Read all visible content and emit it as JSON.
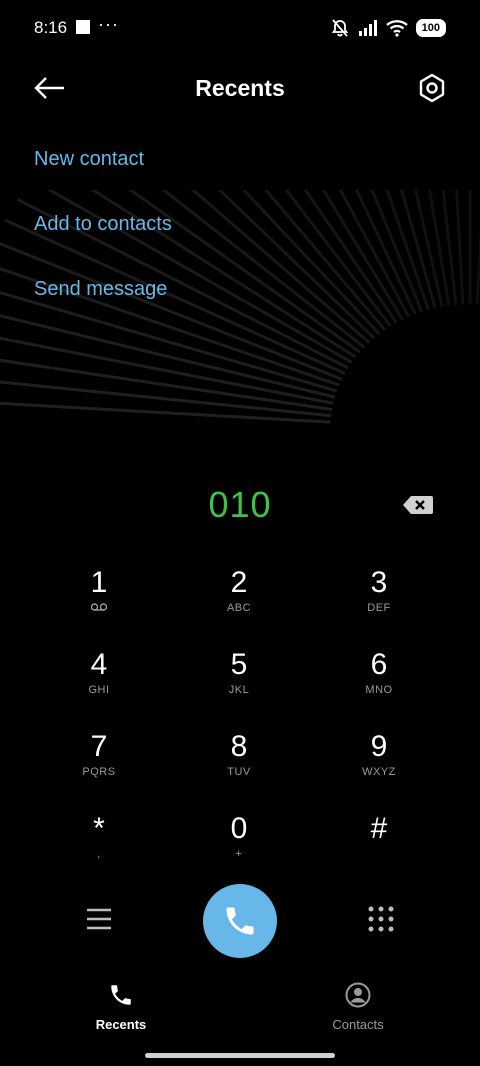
{
  "status_bar": {
    "time": "8:16",
    "more_notifications": "···",
    "battery": "100",
    "icons": [
      "notification-square-icon",
      "mute-bell-icon",
      "signal-icon",
      "wifi-icon",
      "battery-icon"
    ]
  },
  "header": {
    "title": "Recents",
    "back_icon": "arrow-left-icon",
    "settings_icon": "settings-hexagon-icon"
  },
  "actions": {
    "new_contact": "New contact",
    "add_to_contacts": "Add to contacts",
    "send_message": "Send message"
  },
  "dialer": {
    "number": "010",
    "backspace_icon": "backspace-icon"
  },
  "keypad": [
    {
      "digit": "1",
      "letters": ""
    },
    {
      "digit": "2",
      "letters": "ABC"
    },
    {
      "digit": "3",
      "letters": "DEF"
    },
    {
      "digit": "4",
      "letters": "GHI"
    },
    {
      "digit": "5",
      "letters": "JKL"
    },
    {
      "digit": "6",
      "letters": "MNO"
    },
    {
      "digit": "7",
      "letters": "PQRS"
    },
    {
      "digit": "8",
      "letters": "TUV"
    },
    {
      "digit": "9",
      "letters": "WXYZ"
    },
    {
      "digit": "*",
      "letters": ","
    },
    {
      "digit": "0",
      "letters": "+"
    },
    {
      "digit": "#",
      "letters": ""
    }
  ],
  "nav": {
    "recents": "Recents",
    "contacts": "Contacts"
  },
  "colors": {
    "accent": "#67b8e8",
    "number": "#3fc24a",
    "background": "#000000"
  }
}
